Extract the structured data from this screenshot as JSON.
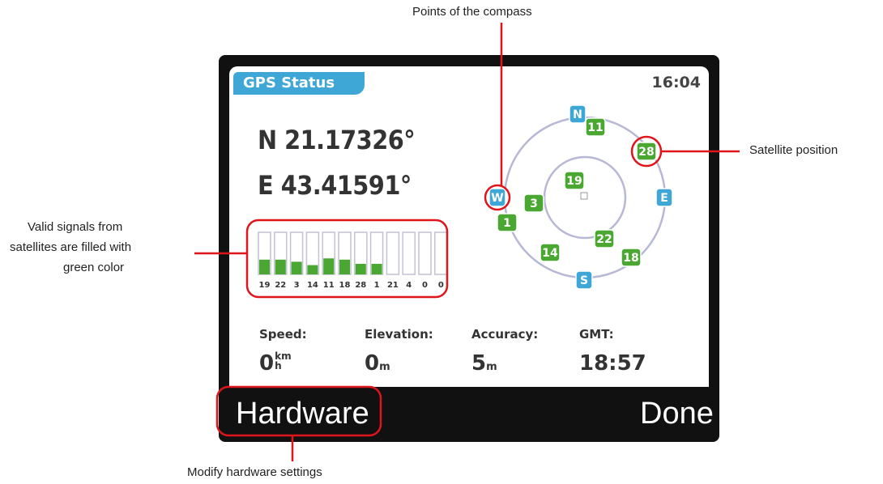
{
  "callouts": {
    "compass": "Points of the compass",
    "satellite": "Satellite position",
    "signals_line1": "Valid signals from",
    "signals_line2": "satellites are filled with",
    "signals_line3": "green color",
    "hardware": "Modify hardware settings"
  },
  "screen": {
    "title": "GPS Status",
    "time": "16:04",
    "latitude": "N 21.17326°",
    "longitude": "E 43.41591°"
  },
  "signal_bars": [
    {
      "label": "19",
      "level": 0.35
    },
    {
      "label": "22",
      "level": 0.35
    },
    {
      "label": "3",
      "level": 0.3
    },
    {
      "label": "14",
      "level": 0.22
    },
    {
      "label": "11",
      "level": 0.38
    },
    {
      "label": "18",
      "level": 0.35
    },
    {
      "label": "28",
      "level": 0.25
    },
    {
      "label": "1",
      "level": 0.25
    },
    {
      "label": "21",
      "level": 0
    },
    {
      "label": "4",
      "level": 0
    },
    {
      "label": "0",
      "level": 0
    },
    {
      "label": "0",
      "level": 0
    }
  ],
  "compass_points": [
    "N",
    "E",
    "S",
    "W"
  ],
  "satellites": [
    "11",
    "28",
    "19",
    "3",
    "1",
    "22",
    "14",
    "18"
  ],
  "stats": {
    "speed_label": "Speed:",
    "speed_value": "0",
    "speed_unit_top": "km",
    "speed_unit_bottom": "h",
    "elevation_label": "Elevation:",
    "elevation_value": "0",
    "elevation_unit": "m",
    "accuracy_label": "Accuracy:",
    "accuracy_value": "5",
    "accuracy_unit": "m",
    "gmt_label": "GMT:",
    "gmt_value": "18:57"
  },
  "softkeys": {
    "left": "Hardware",
    "right": "Done"
  },
  "colors": {
    "accent_blue": "#3ea7d6",
    "satellite_green": "#4aa832",
    "callout_red": "#e0151b",
    "ring": "#b7b7d6"
  }
}
